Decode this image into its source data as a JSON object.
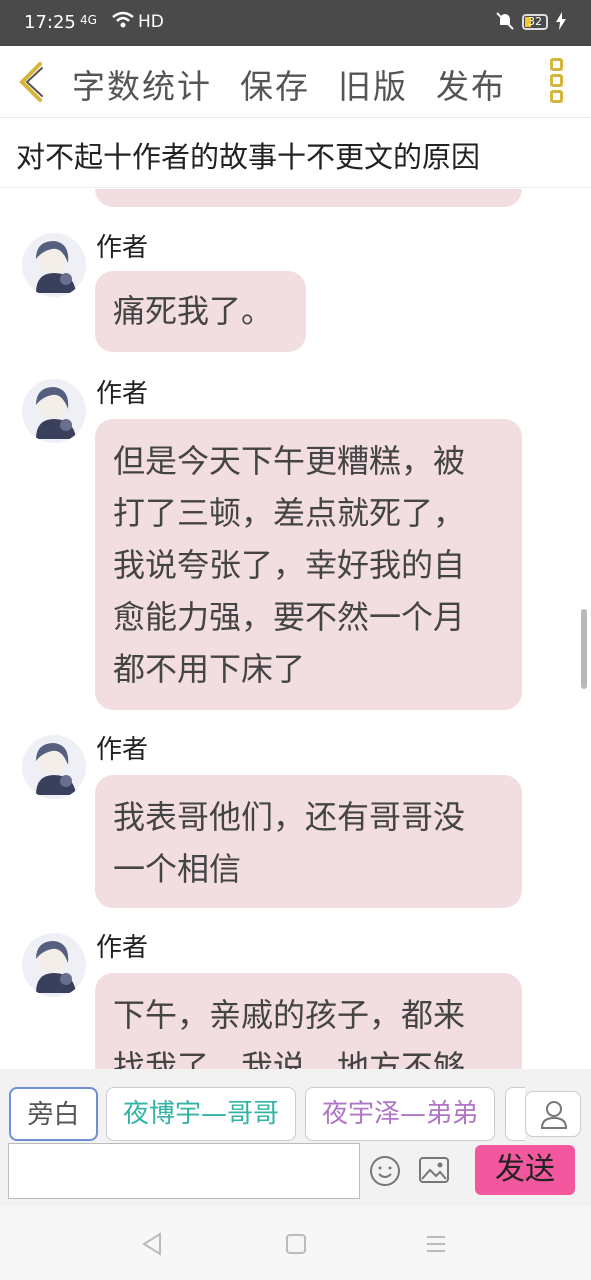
{
  "status_bar": {
    "time": "17:25",
    "signal": "4G",
    "network": "HD",
    "battery": "32"
  },
  "toolbar": {
    "word_count": "字数统计",
    "save": "保存",
    "old_version": "旧版",
    "publish": "发布"
  },
  "story": {
    "title": "对不起十作者的故事十不更文的原因"
  },
  "messages": [
    {
      "author": "作者",
      "lines": [
        "痛死我了。"
      ]
    },
    {
      "author": "作者",
      "lines": [
        "但是今天下午更糟糕，被",
        "打了三顿，差点就死了，",
        "我说夸张了，幸好我的自",
        "愈能力强，要不然一个月",
        "都不用下床了"
      ]
    },
    {
      "author": "作者",
      "lines": [
        "我表哥他们，还有哥哥没",
        "一个相信"
      ]
    },
    {
      "author": "作者",
      "lines": [
        "下午，亲戚的孩子，都来",
        "找我了，我说，地方不够"
      ]
    }
  ],
  "characters": [
    {
      "label": "旁白",
      "color": "#555555"
    },
    {
      "label": "夜博宇—哥哥",
      "color": "#33b3a6"
    },
    {
      "label": "夜宇泽—弟弟",
      "color": "#b074c8"
    }
  ],
  "composer": {
    "input_value": "",
    "send": "发送"
  },
  "colors": {
    "bubble": "#f2dde0",
    "send_button": "#f3579d",
    "accent_icon": "#d6b53b"
  }
}
